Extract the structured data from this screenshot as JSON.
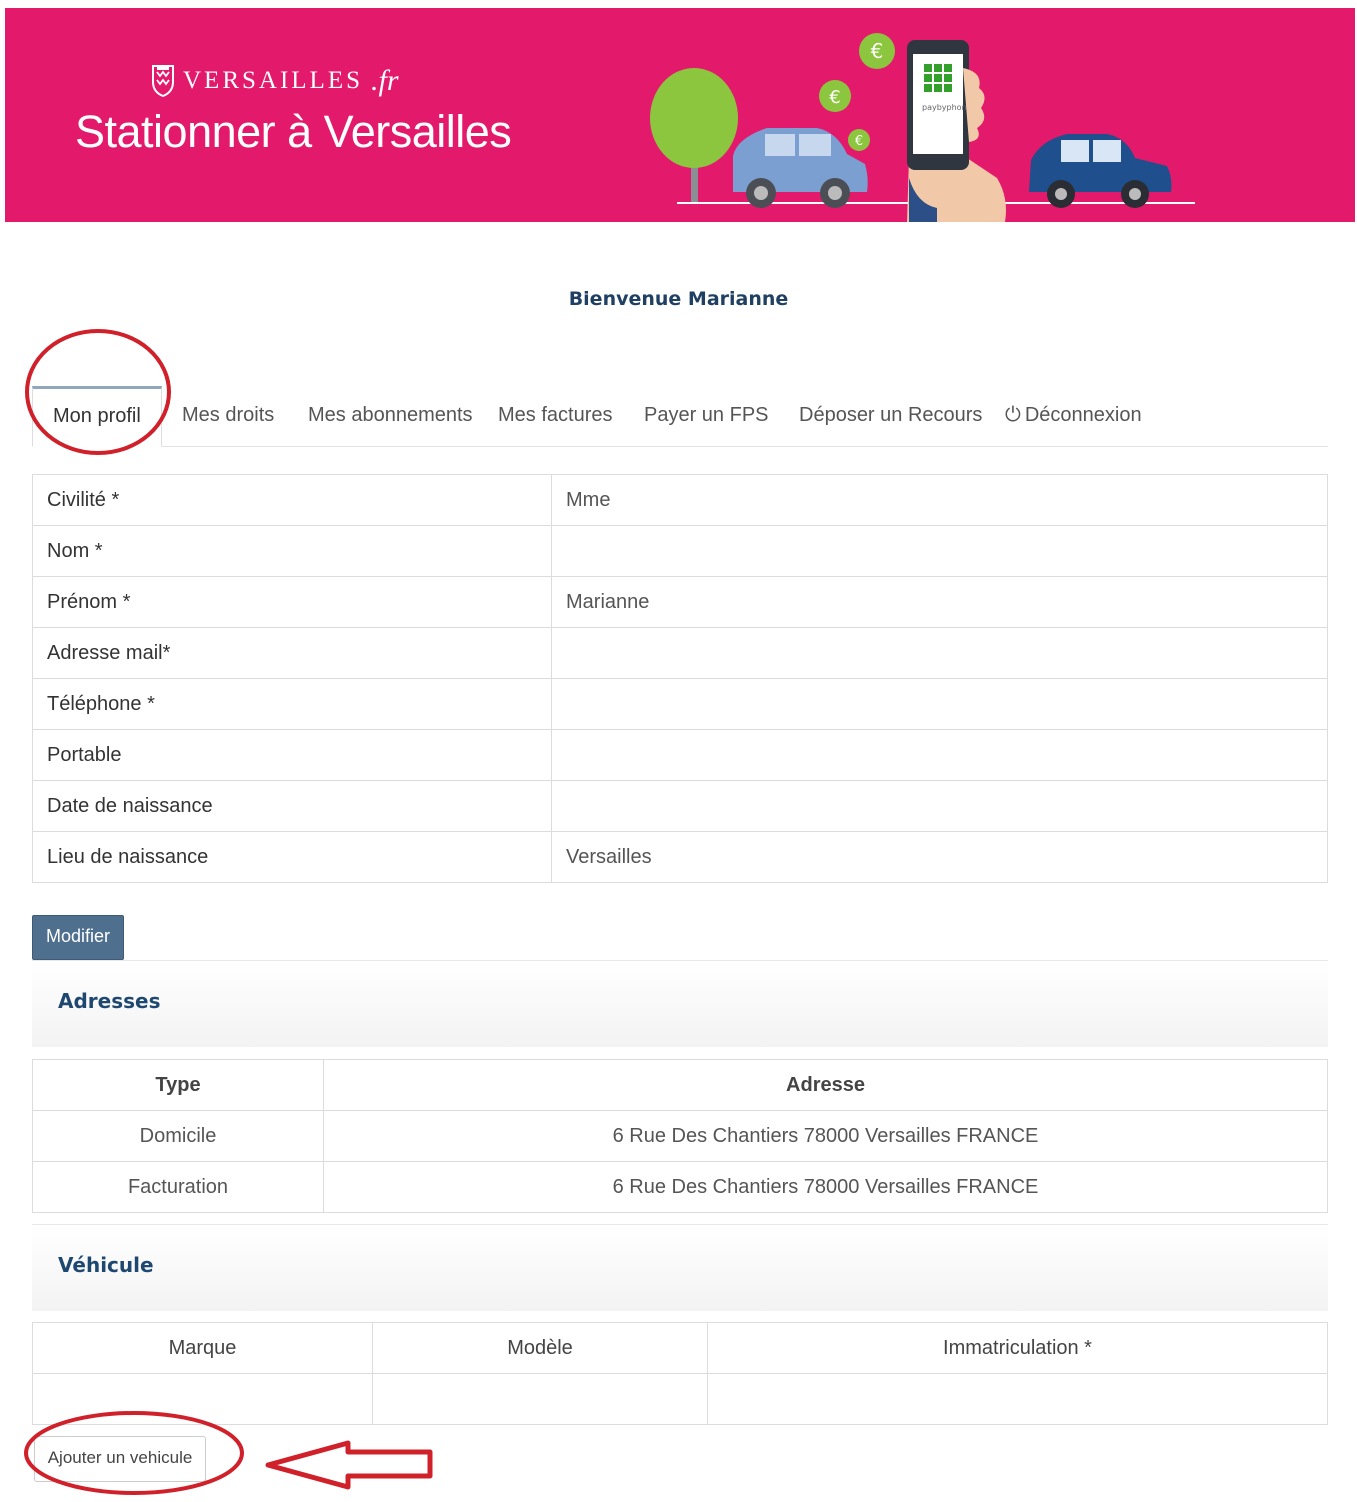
{
  "header": {
    "logo_text": "VERSAILLES",
    "logo_suffix": ".fr",
    "title": "Stationner à Versailles",
    "phone_brand": "paybyphone"
  },
  "welcome": "Bienvenue Marianne",
  "tabs": [
    {
      "label": "Mon profil",
      "active": true
    },
    {
      "label": "Mes droits"
    },
    {
      "label": "Mes abonnements"
    },
    {
      "label": "Mes factures"
    },
    {
      "label": "Payer un FPS"
    },
    {
      "label": "Déposer un Recours"
    },
    {
      "label": "Déconnexion",
      "icon": "power-icon"
    }
  ],
  "profile": [
    {
      "label": "Civilité *",
      "value": "Mme"
    },
    {
      "label": "Nom *",
      "value": ""
    },
    {
      "label": "Prénom *",
      "value": "Marianne"
    },
    {
      "label": "Adresse mail*",
      "value": ""
    },
    {
      "label": "Téléphone *",
      "value": ""
    },
    {
      "label": "Portable",
      "value": ""
    },
    {
      "label": "Date de naissance",
      "value": ""
    },
    {
      "label": "Lieu de naissance",
      "value": "Versailles"
    }
  ],
  "modify_button": "Modifier",
  "addresses": {
    "title": "Adresses",
    "headers": [
      "Type",
      "Adresse"
    ],
    "rows": [
      {
        "type": "Domicile",
        "address": "6 Rue Des Chantiers 78000 Versailles FRANCE"
      },
      {
        "type": "Facturation",
        "address": "6 Rue Des Chantiers 78000 Versailles FRANCE"
      }
    ]
  },
  "vehicles": {
    "title": "Véhicule",
    "headers": [
      "Marque",
      "Modèle",
      "Immatriculation *"
    ],
    "rows": [
      {
        "brand": "",
        "model": "",
        "plate": ""
      }
    ]
  },
  "add_vehicle_button": "Ajouter un vehicule",
  "colors": {
    "banner": "#e31a6c",
    "accent": "#1f4870",
    "button": "#4f6f8f",
    "annotation": "#d0202a"
  }
}
